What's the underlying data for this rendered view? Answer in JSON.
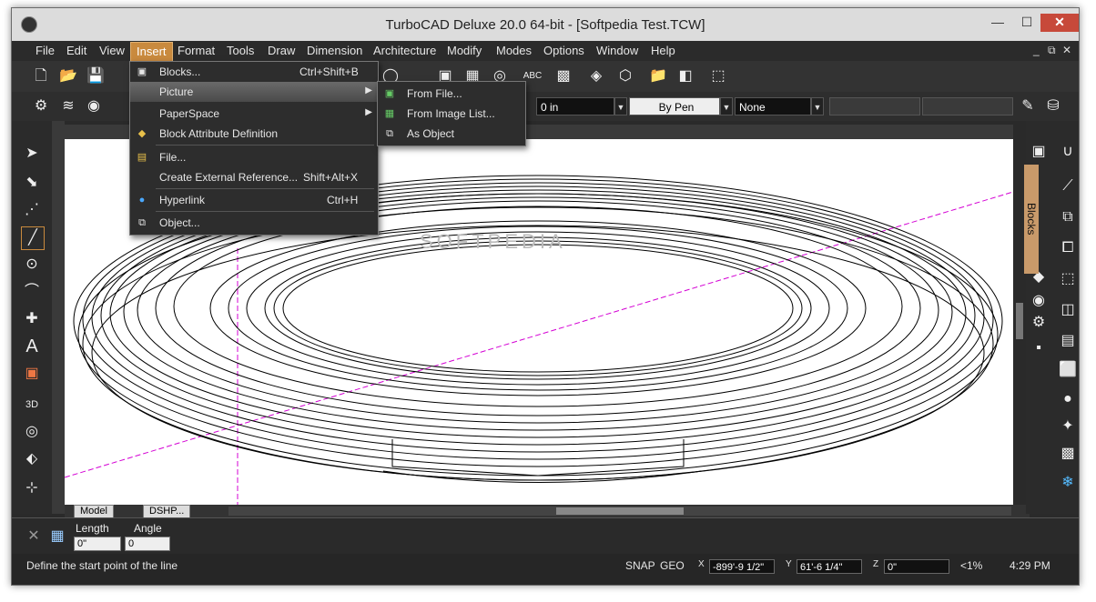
{
  "window": {
    "title": "TurboCAD Deluxe 20.0 64-bit - [Softpedia Test.TCW]",
    "controls": {
      "minimize": "—",
      "maximize": "☐",
      "close": "✕"
    }
  },
  "menubar": {
    "items": [
      "File",
      "Edit",
      "View",
      "Insert",
      "Format",
      "Tools",
      "Draw",
      "Dimension",
      "Architecture",
      "Modify",
      "Modes",
      "Options",
      "Window",
      "Help"
    ],
    "mdi_controls": {
      "minimize": "_",
      "restore": "⧉",
      "close": "✕"
    }
  },
  "toolbar2": {
    "field_1": "0 in",
    "field_2": "By Pen",
    "field_3": "None"
  },
  "insert_menu": {
    "items": [
      {
        "label": "Blocks...",
        "shortcut": "Ctrl+Shift+B",
        "icon": "blocks-icon"
      },
      {
        "label": "Picture",
        "shortcut": "",
        "icon": "picture-icon"
      },
      {
        "label": "PaperSpace",
        "shortcut": "",
        "icon": ""
      },
      {
        "label": "Block Attribute Definition",
        "shortcut": "",
        "icon": "attribute-icon"
      },
      {
        "label": "File...",
        "shortcut": "",
        "icon": "file-icon"
      },
      {
        "label": "Create External Reference...",
        "shortcut": "Shift+Alt+X",
        "icon": ""
      },
      {
        "label": "Hyperlink",
        "shortcut": "Ctrl+H",
        "icon": "globe-icon"
      },
      {
        "label": "Object...",
        "shortcut": "",
        "icon": "object-icon"
      }
    ]
  },
  "picture_submenu": {
    "items": [
      {
        "label": "From File...",
        "icon": "picture-file-icon"
      },
      {
        "label": "From Image List...",
        "icon": "image-list-icon"
      },
      {
        "label": "As Object",
        "icon": "as-object-icon"
      }
    ]
  },
  "tabs": {
    "model": "Model",
    "paper": "DSHP..."
  },
  "right_panel": {
    "blocks_tab": "Blocks"
  },
  "watermark": "SOFTPEDIA",
  "inspector": {
    "length_label": "Length",
    "angle_label": "Angle",
    "length_value": "0\"",
    "angle_value": "0"
  },
  "status": {
    "prompt": "Define the start point of the line",
    "snap": "SNAP",
    "geo": "GEO",
    "x_value": "-899'-9 1/2\"",
    "y_value": "61'-6 1/4\"",
    "z_value": "0\"",
    "zoom": "<1%",
    "time": "4:29 PM"
  },
  "colors": {
    "accent": "#c98a3e",
    "magenta_guide": "#d400d4"
  }
}
